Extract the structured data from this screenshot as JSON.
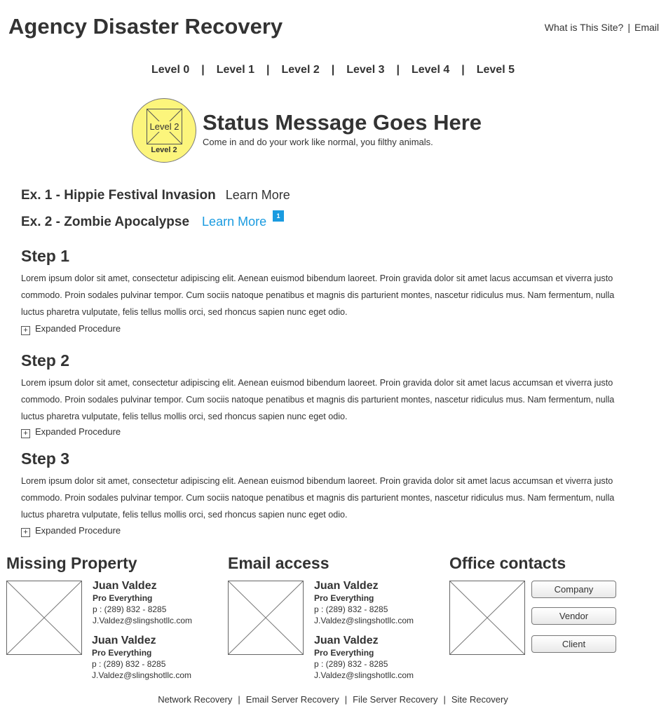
{
  "header": {
    "title": "Agency Disaster Recovery",
    "links": [
      "What is This Site?",
      "Email"
    ],
    "separator": "|"
  },
  "levels": {
    "items": [
      "Level 0",
      "Level 1",
      "Level 2",
      "Level 3",
      "Level 4",
      "Level 5"
    ],
    "separator": "|"
  },
  "status": {
    "badge_image_label": "Level 2",
    "badge_label": "Level 2",
    "badge_color": "#fcf57c",
    "title": "Status Message Goes Here",
    "subtitle": "Come in and do your work like normal, you filthy animals."
  },
  "examples": [
    {
      "title": "Ex. 1 - Hippie Festival Invasion",
      "link": "Learn More"
    },
    {
      "title": "Ex. 2 - Zombie Apocalypse",
      "link": "Learn More",
      "note_badge": "1",
      "link_color": "#1a9be0"
    }
  ],
  "steps": [
    {
      "title": "Step 1",
      "body": "Lorem ipsum dolor sit amet, consectetur adipiscing elit. Aenean euismod bibendum laoreet. Proin gravida dolor sit amet lacus accumsan et viverra justo commodo. Proin sodales pulvinar tempor. Cum sociis natoque penatibus et magnis dis parturient montes, nascetur ridiculus mus. Nam fermentum, nulla luctus pharetra vulputate, felis tellus mollis orci, sed rhoncus sapien nunc eget odio.",
      "expander": "Expanded Procedure"
    },
    {
      "title": "Step 2",
      "body": "Lorem ipsum dolor sit amet, consectetur adipiscing elit. Aenean euismod bibendum laoreet. Proin gravida dolor sit amet lacus accumsan et viverra justo commodo. Proin sodales pulvinar tempor. Cum sociis natoque penatibus et magnis dis parturient montes, nascetur ridiculus mus. Nam fermentum, nulla luctus pharetra vulputate, felis tellus mollis orci, sed rhoncus sapien nunc eget odio.",
      "expander": "Expanded Procedure"
    },
    {
      "title": "Step 3",
      "body": "Lorem ipsum dolor sit amet, consectetur adipiscing elit. Aenean euismod bibendum laoreet. Proin gravida dolor sit amet lacus accumsan et viverra justo commodo. Proin sodales pulvinar tempor. Cum sociis natoque penatibus et magnis dis parturient montes, nascetur ridiculus mus. Nam fermentum, nulla luctus pharetra vulputate, felis tellus mollis orci, sed rhoncus sapien nunc eget odio.",
      "expander": "Expanded Procedure"
    }
  ],
  "expander_icon": "plus-icon",
  "footer": {
    "missing_property": {
      "title": "Missing Property",
      "contacts": [
        {
          "name": "Juan Valdez",
          "role": "Pro Everything",
          "phone": "p : (289) 832 - 8285",
          "email": "J.Valdez@slingshotllc.com"
        },
        {
          "name": "Juan Valdez",
          "role": "Pro Everything",
          "phone": "p : (289) 832 - 8285",
          "email": "J.Valdez@slingshotllc.com"
        }
      ]
    },
    "email_access": {
      "title": "Email access",
      "contacts": [
        {
          "name": "Juan Valdez",
          "role": "Pro Everything",
          "phone": "p : (289) 832 - 8285",
          "email": "J.Valdez@slingshotllc.com"
        },
        {
          "name": "Juan Valdez",
          "role": "Pro Everything",
          "phone": "p : (289) 832 - 8285",
          "email": "J.Valdez@slingshotllc.com"
        }
      ]
    },
    "office_contacts": {
      "title": "Office contacts",
      "buttons": [
        "Company",
        "Vendor",
        "Client"
      ]
    }
  },
  "bottom_links": {
    "items": [
      "Network Recovery",
      "Email Server Recovery",
      "File Server Recovery",
      "Site Recovery"
    ],
    "separator": "|"
  }
}
